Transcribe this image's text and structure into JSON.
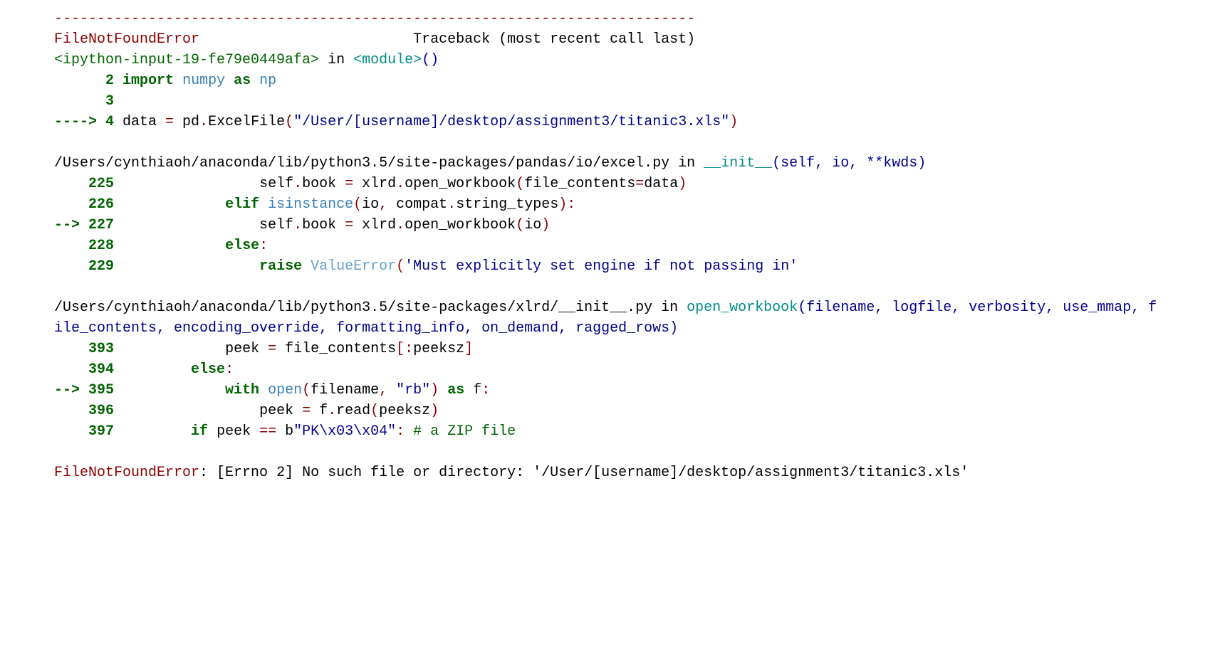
{
  "sep": "---------------------------------------------------------------------------",
  "err": "FileNotFoundError",
  "trace_header_right": "Traceback (most recent call last)",
  "frame1": {
    "file": "<ipython-input-19-fe79e0449afa>",
    "in": " in ",
    "func": "<module>",
    "parens": "()",
    "l2a": "      2 ",
    "l2b": "import",
    "l2c": " ",
    "l2d": "numpy",
    "l2e": " ",
    "l2f": "as",
    "l2g": " ",
    "l2h": "np",
    "l3a": "      3 ",
    "l4a": "----> 4 ",
    "l4b": "data ",
    "l4c": "=",
    "l4d": " pd",
    "l4e": ".",
    "l4f": "ExcelFile",
    "l4g": "(",
    "l4h": "\"/User/[username]/desktop/assignment3/titanic3.xls\"",
    "l4i": ")"
  },
  "frame2": {
    "path": "/Users/cynthiaoh/anaconda/lib/python3.5/site-packages/pandas/io/excel.py",
    "in": " in ",
    "func": "__init__",
    "sig": "(self, io, **kwds)",
    "l225_gut": "    225 ",
    "l225_indent": "                ",
    "l226_gut": "    226 ",
    "l226_indent": "            ",
    "l227_gut": "--> 227 ",
    "l227_indent": "                ",
    "l228_gut": "    228 ",
    "l228_indent": "            ",
    "l229_gut": "    229 ",
    "l229_indent": "                ",
    "t_elif": "elif",
    "t_isinstance": " isinstance",
    "t_else": "else",
    "t_raise": "raise",
    "t_ValueError": " ValueError",
    "t225a": "self",
    "t225b": ".",
    "t225c": "book ",
    "t225d": "=",
    "t225e": " xlrd",
    "t225f": ".",
    "t225g": "open_workbook",
    "t225h": "(",
    "t225i": "file_contents",
    "t225j": "=",
    "t225k": "data",
    "t225l": ")",
    "t226b": "(",
    "t226c": "io",
    "t226d": ",",
    "t226e": " compat",
    "t226f": ".",
    "t226g": "string_types",
    "t226h": ")",
    "t226i": ":",
    "t227a": "self",
    "t227b": ".",
    "t227c": "book ",
    "t227d": "=",
    "t227e": " xlrd",
    "t227f": ".",
    "t227g": "open_workbook",
    "t227h": "(",
    "t227i": "io",
    "t227j": ")",
    "t228a": ":",
    "t229b": "(",
    "t229c": "'Must explicitly set engine if not passing in'"
  },
  "frame3": {
    "path": "/Users/cynthiaoh/anaconda/lib/python3.5/site-packages/xlrd/__init__.py",
    "in": " in ",
    "func": "open_workbook",
    "sig": "(filename, logfile, verbosity, use_mmap, file_contents, encoding_override, formatting_info, on_demand, ragged_rows)",
    "l393_gut": "    393 ",
    "l393_indent": "            ",
    "l394_gut": "    394 ",
    "l394_indent": "        ",
    "l395_gut": "--> 395 ",
    "l395_indent": "            ",
    "l396_gut": "    396 ",
    "l396_indent": "                ",
    "l397_gut": "    397 ",
    "l397_indent": "        ",
    "t393a": "peek ",
    "t393b": "=",
    "t393c": " file_contents",
    "t393d": "[",
    "t393e": ":",
    "t393f": "peeksz",
    "t393g": "]",
    "t_else": "else",
    "t394a": ":",
    "t_with": "with",
    "t_open": " open",
    "t395b": "(",
    "t395c": "filename",
    "t395d": ",",
    "t395e": " ",
    "t395f": "\"rb\"",
    "t395g": ")",
    "t395h": " ",
    "t_as": "as",
    "t395i": " f",
    "t395j": ":",
    "t396a": "peek ",
    "t396b": "=",
    "t396c": " f",
    "t396d": ".",
    "t396e": "read",
    "t396f": "(",
    "t396g": "peeksz",
    "t396h": ")",
    "t_if": "if",
    "t397a": " peek ",
    "t397b": "==",
    "t397c": " b",
    "t397d": "\"PK\\x03\\x04\"",
    "t397e": ":",
    "t397f": " # a ZIP file"
  },
  "final": {
    "err": "FileNotFoundError",
    "rest": ": [Errno 2] No such file or directory: '/User/[username]/desktop/assignment3/titanic3.xls'"
  }
}
